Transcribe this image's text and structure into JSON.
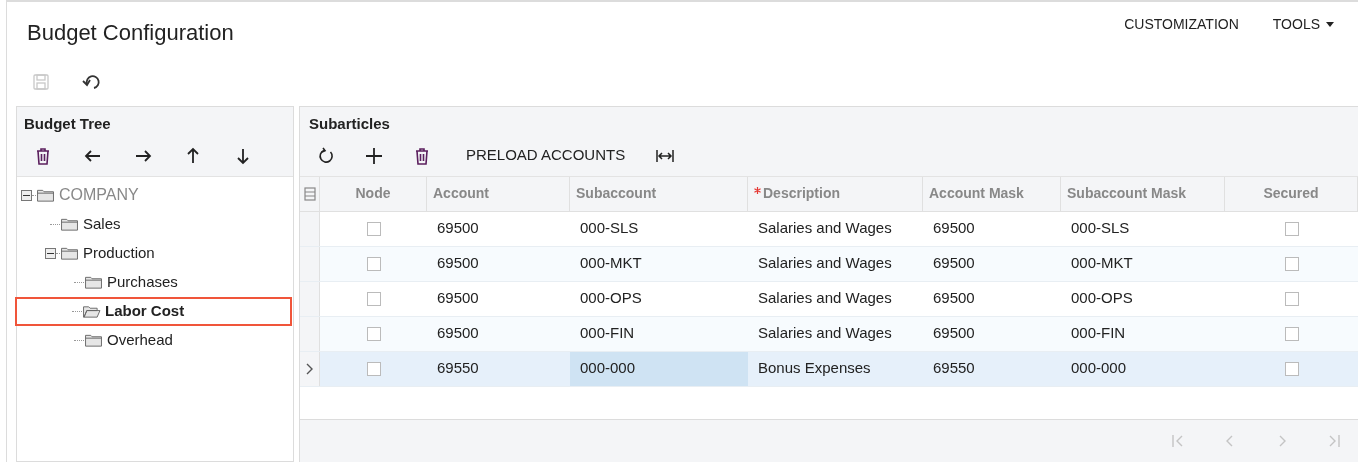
{
  "page": {
    "title": "Budget Configuration"
  },
  "header_links": [
    {
      "kind": "link",
      "label": "CUSTOMIZATION"
    },
    {
      "kind": "menu",
      "label": "TOOLS"
    }
  ],
  "toolbar": [
    {
      "kind": "save",
      "disabled": true
    },
    {
      "kind": "undo",
      "disabled": false
    }
  ],
  "budget_tree": {
    "title": "Budget Tree",
    "toolbar": [
      {
        "kind": "delete"
      },
      {
        "kind": "left"
      },
      {
        "kind": "right"
      },
      {
        "kind": "up"
      },
      {
        "kind": "down"
      }
    ],
    "nodes": [
      {
        "label": "COMPANY",
        "expanded": true,
        "selected": false,
        "children": [
          {
            "label": "Sales",
            "selected": false
          },
          {
            "label": "Production",
            "expanded": true,
            "selected": false,
            "children": [
              {
                "label": "Purchases",
                "selected": false
              },
              {
                "label": "Labor Cost",
                "selected": true
              },
              {
                "label": "Overhead",
                "selected": false
              }
            ]
          }
        ]
      }
    ]
  },
  "subarticles": {
    "title": "Subarticles",
    "toolbar": [
      {
        "kind": "refresh"
      },
      {
        "kind": "add"
      },
      {
        "kind": "delete"
      },
      {
        "kind": "text",
        "label": "PRELOAD ACCOUNTS"
      },
      {
        "kind": "fit"
      }
    ],
    "columns": [
      {
        "label": "Node",
        "required": false
      },
      {
        "label": "Account",
        "required": false
      },
      {
        "label": "Subaccount",
        "required": false
      },
      {
        "label": "Description",
        "required": true
      },
      {
        "label": "Account Mask",
        "required": false
      },
      {
        "label": "Subaccount Mask",
        "required": false
      },
      {
        "label": "Secured",
        "required": false
      }
    ],
    "rows": [
      {
        "selected": false,
        "node": false,
        "account": "69500",
        "subaccount": "000-SLS",
        "description": "Salaries and Wages",
        "account_mask": "69500",
        "subaccount_mask": "000-SLS",
        "secured": false
      },
      {
        "selected": false,
        "node": false,
        "account": "69500",
        "subaccount": "000-MKT",
        "description": "Salaries and Wages",
        "account_mask": "69500",
        "subaccount_mask": "000-MKT",
        "secured": false
      },
      {
        "selected": false,
        "node": false,
        "account": "69500",
        "subaccount": "000-OPS",
        "description": "Salaries and Wages",
        "account_mask": "69500",
        "subaccount_mask": "000-OPS",
        "secured": false
      },
      {
        "selected": false,
        "node": false,
        "account": "69500",
        "subaccount": "000-FIN",
        "description": "Salaries and Wages",
        "account_mask": "69500",
        "subaccount_mask": "000-FIN",
        "secured": false
      },
      {
        "selected": true,
        "node": false,
        "account": "69550",
        "subaccount": "000-000",
        "description": "Bonus Expenses",
        "account_mask": "69550",
        "subaccount_mask": "000-000",
        "secured": false
      }
    ],
    "pager": {
      "disabled": true
    }
  }
}
